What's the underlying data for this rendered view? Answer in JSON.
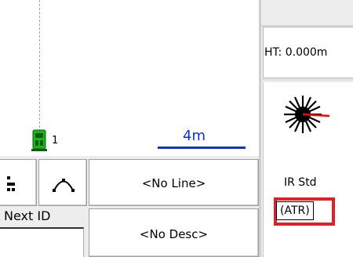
{
  "map": {
    "instrument_label": "1",
    "scale_label": "4m",
    "icons": [
      "instrument-icon"
    ],
    "colors": {
      "scale": "#0a35d6",
      "instrument": "#1bb31b"
    }
  },
  "status_panel": {
    "ht_text": "HT: 0.000m",
    "prism_label": "IR Std",
    "atr_label": "(ATR)",
    "icons": [
      "prism-target-icon"
    ],
    "colors": {
      "highlight": "#e11f26",
      "laser": "#ff0000"
    }
  },
  "toolbar": {
    "line_label": "<No Line>",
    "desc_label": "<No Desc>",
    "next_id_label": "Next ID",
    "next_id_value": "",
    "icons": [
      "point-code-icon",
      "arc-icon"
    ]
  }
}
